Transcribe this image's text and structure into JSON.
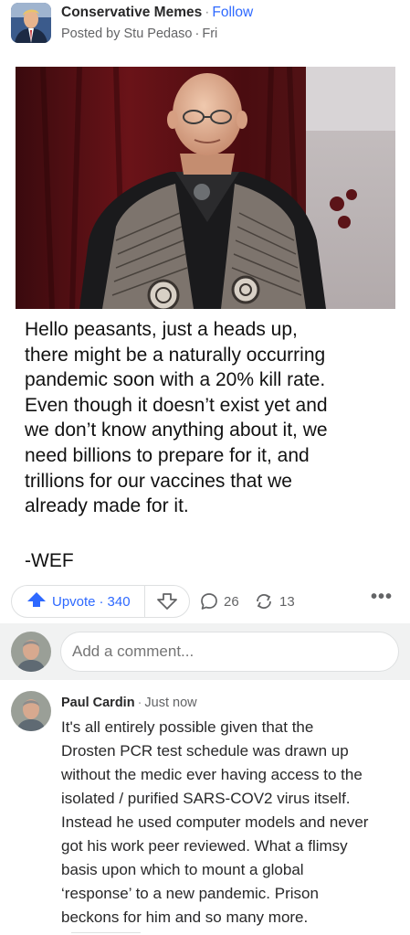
{
  "post": {
    "space_name": "Conservative Memes",
    "follow_label": "Follow",
    "posted_by": "Posted by Stu Pedaso",
    "posted_when": "Fri",
    "meme_text": "Hello peasants, just a heads up,\nthere might be a naturally occurring\npandemic soon with a 20% kill rate.\nEven though it doesn’t exist yet and\nwe don’t know anything about it, we\nneed billions to prepare for it, and\ntrillions for our vaccines that we\nalready made for it.",
    "meme_signature": "-WEF"
  },
  "actions": {
    "upvote_label": "Upvote",
    "upvote_count": "340",
    "comment_count": "26",
    "share_count": "13",
    "accent_color": "#2e69ff"
  },
  "comment_box": {
    "placeholder": "Add a comment..."
  },
  "comment": {
    "author": "Paul Cardin",
    "time": "Just now",
    "text": "It's all entirely possible given that the\nDrosten PCR test schedule was drawn up\nwithout the medic ever having access to the\nisolated / purified SARS-COV2 virus itself.\nInstead he used computer models and never\ngot his work peer reviewed. What a flimsy\nbasis upon which to mount a global\n‘response’ to a new pandemic. Prison\nbeckons for him and so many more."
  }
}
